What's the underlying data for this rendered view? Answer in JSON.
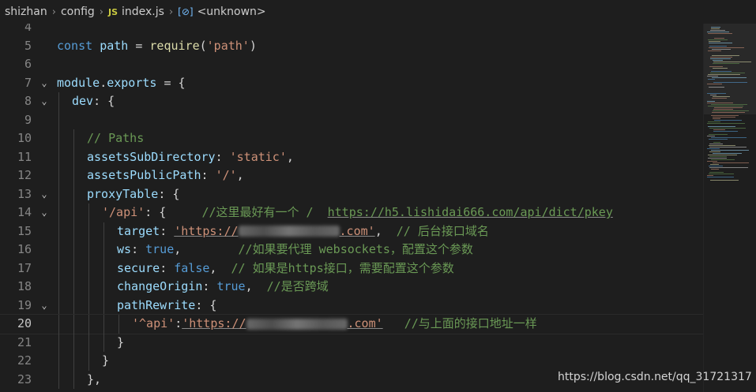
{
  "breadcrumb": {
    "items": [
      "shizhan",
      "config",
      "index.js",
      "<unknown>"
    ],
    "js_badge": "JS",
    "symbol_icon": "[⊘]"
  },
  "colors": {
    "background": "#1e1e1e",
    "keyword": "#569cd6",
    "variable": "#9cdcfe",
    "function": "#dcdcaa",
    "string": "#ce9178",
    "comment": "#6a9955",
    "punctuation": "#d4d4d4"
  },
  "editor": {
    "current_line": "20",
    "lines": [
      {
        "num": "4",
        "indent": 0,
        "fold": "",
        "tokens": []
      },
      {
        "num": "5",
        "indent": 0,
        "fold": "",
        "tokens": [
          {
            "t": "const",
            "c": "kw"
          },
          {
            "t": " ",
            "c": "pun"
          },
          {
            "t": "path",
            "c": "var"
          },
          {
            "t": " = ",
            "c": "pun"
          },
          {
            "t": "require",
            "c": "fn"
          },
          {
            "t": "(",
            "c": "pun"
          },
          {
            "t": "'path'",
            "c": "str"
          },
          {
            "t": ")",
            "c": "pun"
          }
        ]
      },
      {
        "num": "6",
        "indent": 0,
        "fold": "",
        "tokens": []
      },
      {
        "num": "7",
        "indent": 0,
        "fold": "⌄",
        "tokens": [
          {
            "t": "module",
            "c": "var"
          },
          {
            "t": ".",
            "c": "pun"
          },
          {
            "t": "exports",
            "c": "var"
          },
          {
            "t": " = {",
            "c": "pun"
          }
        ]
      },
      {
        "num": "8",
        "indent": 1,
        "fold": "⌄",
        "tokens": [
          {
            "t": "dev",
            "c": "var"
          },
          {
            "t": ": {",
            "c": "pun"
          }
        ]
      },
      {
        "num": "9",
        "indent": 1,
        "fold": "",
        "tokens": []
      },
      {
        "num": "10",
        "indent": 2,
        "fold": "",
        "tokens": [
          {
            "t": "// Paths",
            "c": "cm"
          }
        ]
      },
      {
        "num": "11",
        "indent": 2,
        "fold": "",
        "tokens": [
          {
            "t": "assetsSubDirectory",
            "c": "var"
          },
          {
            "t": ": ",
            "c": "pun"
          },
          {
            "t": "'static'",
            "c": "str"
          },
          {
            "t": ",",
            "c": "pun"
          }
        ]
      },
      {
        "num": "12",
        "indent": 2,
        "fold": "",
        "tokens": [
          {
            "t": "assetsPublicPath",
            "c": "var"
          },
          {
            "t": ": ",
            "c": "pun"
          },
          {
            "t": "'/'",
            "c": "str"
          },
          {
            "t": ",",
            "c": "pun"
          }
        ]
      },
      {
        "num": "13",
        "indent": 2,
        "fold": "⌄",
        "tokens": [
          {
            "t": "proxyTable",
            "c": "var"
          },
          {
            "t": ": {",
            "c": "pun"
          }
        ]
      },
      {
        "num": "14",
        "indent": 3,
        "fold": "⌄",
        "tokens": [
          {
            "t": "'/api'",
            "c": "str"
          },
          {
            "t": ": {     ",
            "c": "pun"
          },
          {
            "t": "//这里最好有一个 /  ",
            "c": "cm"
          },
          {
            "t": "https://h5.lishidai666.com/api/dict/pkey",
            "c": "cm ul"
          }
        ]
      },
      {
        "num": "15",
        "indent": 4,
        "fold": "",
        "tokens": [
          {
            "t": "target",
            "c": "var"
          },
          {
            "t": ": ",
            "c": "pun"
          },
          {
            "t": "'https://",
            "c": "str ul"
          },
          {
            "t": "",
            "c": "blur"
          },
          {
            "t": ".com'",
            "c": "str ul"
          },
          {
            "t": ",  ",
            "c": "pun"
          },
          {
            "t": "// 后台接口域名",
            "c": "cm"
          }
        ]
      },
      {
        "num": "16",
        "indent": 4,
        "fold": "",
        "tokens": [
          {
            "t": "ws",
            "c": "var"
          },
          {
            "t": ": ",
            "c": "pun"
          },
          {
            "t": "true",
            "c": "kw"
          },
          {
            "t": ",        ",
            "c": "pun"
          },
          {
            "t": "//如果要代理 websockets，配置这个参数",
            "c": "cm"
          }
        ]
      },
      {
        "num": "17",
        "indent": 4,
        "fold": "",
        "tokens": [
          {
            "t": "secure",
            "c": "var"
          },
          {
            "t": ": ",
            "c": "pun"
          },
          {
            "t": "false",
            "c": "kw"
          },
          {
            "t": ",  ",
            "c": "pun"
          },
          {
            "t": "// 如果是https接口，需要配置这个参数",
            "c": "cm"
          }
        ]
      },
      {
        "num": "18",
        "indent": 4,
        "fold": "",
        "tokens": [
          {
            "t": "changeOrigin",
            "c": "var"
          },
          {
            "t": ": ",
            "c": "pun"
          },
          {
            "t": "true",
            "c": "kw"
          },
          {
            "t": ",  ",
            "c": "pun"
          },
          {
            "t": "//是否跨域",
            "c": "cm"
          }
        ]
      },
      {
        "num": "19",
        "indent": 4,
        "fold": "⌄",
        "tokens": [
          {
            "t": "pathRewrite",
            "c": "var"
          },
          {
            "t": ": {",
            "c": "pun"
          }
        ]
      },
      {
        "num": "20",
        "indent": 5,
        "fold": "",
        "tokens": [
          {
            "t": "'^api'",
            "c": "str"
          },
          {
            "t": ":",
            "c": "pun"
          },
          {
            "t": "'https://",
            "c": "str ul"
          },
          {
            "t": "",
            "c": "blur"
          },
          {
            "t": ".com'",
            "c": "str ul"
          },
          {
            "t": "   ",
            "c": "pun"
          },
          {
            "t": "//与上面的接口地址一样",
            "c": "cm"
          }
        ]
      },
      {
        "num": "21",
        "indent": 4,
        "fold": "",
        "tokens": [
          {
            "t": "}",
            "c": "pun"
          }
        ]
      },
      {
        "num": "22",
        "indent": 3,
        "fold": "",
        "tokens": [
          {
            "t": "}",
            "c": "pun"
          }
        ]
      },
      {
        "num": "23",
        "indent": 2,
        "fold": "",
        "tokens": [
          {
            "t": "},",
            "c": "pun"
          }
        ]
      }
    ]
  },
  "watermark": "https://blog.csdn.net/qq_31721317"
}
